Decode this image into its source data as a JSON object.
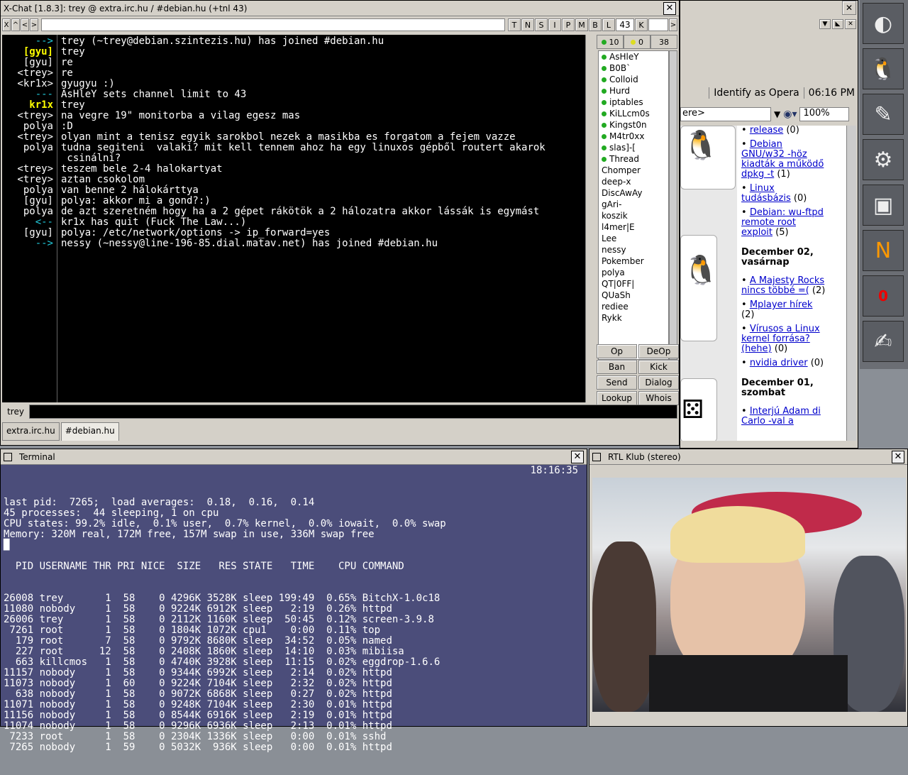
{
  "xchat": {
    "title": "X-Chat [1.8.3]: trey @ extra.irc.hu / #debian.hu (+tnl 43)",
    "toolbar": {
      "btn_x": "X",
      "btn_up": "^",
      "btn_left": "<",
      "btn_right": ">",
      "modes": [
        "T",
        "N",
        "S",
        "I",
        "P",
        "M",
        "B",
        "L"
      ],
      "limit": "43",
      "btn_k": "K",
      "btn_end": ">"
    },
    "lines": [
      {
        "nick": "-->",
        "text": "trey (~trey@debian.szintezis.hu) has joined #debian.hu",
        "type": "join"
      },
      {
        "nick": "[gyu]",
        "text": "trey",
        "type": "hl"
      },
      {
        "nick": "[gyu]",
        "text": "re",
        "type": "n"
      },
      {
        "nick": "<trey>",
        "text": "re",
        "type": "n"
      },
      {
        "nick": "<kr1x>",
        "text": "gyugyu :)",
        "type": "n"
      },
      {
        "nick": "---",
        "text": "AsHleY sets channel limit to 43",
        "type": "sys"
      },
      {
        "nick": "kr1x",
        "text": "trey",
        "type": "hl"
      },
      {
        "nick": "<trey>",
        "text": "na vegre 19\" monitorba a vilag egesz mas",
        "type": "n"
      },
      {
        "nick": "polya",
        "text": ":D",
        "type": "n"
      },
      {
        "nick": "<trey>",
        "text": "olyan mint a tenisz egyik sarokbol nezek a masikba es forgatom a fejem vazze",
        "type": "n"
      },
      {
        "nick": "polya",
        "text": "tudna segiteni  valaki? mit kell tennem ahoz ha egy linuxos gépből routert akarok",
        "type": "n"
      },
      {
        "nick": "",
        "text": " csinálni?",
        "type": "n"
      },
      {
        "nick": "<trey>",
        "text": "teszem bele 2-4 halokartyat",
        "type": "n"
      },
      {
        "nick": "<trey>",
        "text": "aztan csokolom",
        "type": "n"
      },
      {
        "nick": "polya",
        "text": "van benne 2 hálokárttya",
        "type": "n"
      },
      {
        "nick": "[gyu]",
        "text": "polya: akkor mi a gond?:)",
        "type": "n"
      },
      {
        "nick": "polya",
        "text": "de azt szeretném hogy ha a 2 gépet rákötök a 2 hálozatra akkor lássák is egymást",
        "type": "n"
      },
      {
        "nick": "<--",
        "text": "kr1x has quit (Fuck The Law...)",
        "type": "quit"
      },
      {
        "nick": "[gyu]",
        "text": "polya: /etc/network/options -> ip_forward=yes",
        "type": "n"
      },
      {
        "nick": "-->",
        "text": "nessy (~nessy@line-196-85.dial.matav.net) has joined #debian.hu",
        "type": "join2"
      }
    ],
    "counts": {
      "ops": "10",
      "voice": "0",
      "total": "38"
    },
    "users": [
      {
        "name": "AsHleY",
        "op": true
      },
      {
        "name": "B0B`",
        "op": true
      },
      {
        "name": "Colloid",
        "op": true
      },
      {
        "name": "Hurd",
        "op": true
      },
      {
        "name": "iptables",
        "op": true
      },
      {
        "name": "KiLLcm0s",
        "op": true
      },
      {
        "name": "Kingst0n",
        "op": true
      },
      {
        "name": "M4tr0xx",
        "op": true
      },
      {
        "name": "slas]-[",
        "op": true
      },
      {
        "name": "Thread",
        "op": true
      },
      {
        "name": "Chomper",
        "op": false
      },
      {
        "name": "deep-x",
        "op": false
      },
      {
        "name": "DiscAwAy",
        "op": false
      },
      {
        "name": "gAri-",
        "op": false
      },
      {
        "name": "koszik",
        "op": false
      },
      {
        "name": "l4mer|E",
        "op": false
      },
      {
        "name": "Lee",
        "op": false
      },
      {
        "name": "nessy",
        "op": false
      },
      {
        "name": "Pokember",
        "op": false
      },
      {
        "name": "polya",
        "op": false
      },
      {
        "name": "QT|0FF|",
        "op": false
      },
      {
        "name": "QUaSh",
        "op": false
      },
      {
        "name": "rediee",
        "op": false
      },
      {
        "name": "Rykk",
        "op": false
      }
    ],
    "buttons": [
      "Op",
      "DeOp",
      "Ban",
      "Kick",
      "Send",
      "Dialog",
      "Lookup",
      "Whois"
    ],
    "input_nick": "trey",
    "tabs": [
      "extra.irc.hu",
      "#debian.hu"
    ]
  },
  "opera": {
    "identify": "Identify as Opera",
    "time": "06:16 PM",
    "address": "ere>",
    "zoom": "100%",
    "news": [
      {
        "link": "release",
        "count": " (0)"
      },
      {
        "link": "Debian GNU/w32 -höz kiadták a működő dpkg -t",
        "count": " (1)"
      },
      {
        "link": "Linux tudásbázis",
        "count": " (0)"
      },
      {
        "link": "Debian: wu-ftpd remote root exploit",
        "count": " (5)"
      }
    ],
    "day1": "December 02, vasárnap",
    "news2": [
      {
        "link": "A Majesty Rocks nincs többé =(",
        "count": " (2)"
      },
      {
        "link": "Mplayer hírek",
        "count": " (2)"
      },
      {
        "link": "Vírusos a Linux kernel forrása? (hehe)",
        "count": " (0)"
      },
      {
        "link": "nvidia driver",
        "count": " (0)"
      }
    ],
    "day2": "December 01, szombat",
    "news3": [
      {
        "link": "Interjú Adam di Carlo -val a",
        "count": ""
      }
    ]
  },
  "terminal": {
    "title": "Terminal",
    "clock": "18:16:35",
    "header": [
      "last pid:  7265;  load averages:  0.18,  0.16,  0.14",
      "45 processes:  44 sleeping, 1 on cpu",
      "CPU states: 99.2% idle,  0.1% user,  0.7% kernel,  0.0% iowait,  0.0% swap",
      "Memory: 320M real, 172M free, 157M swap in use, 336M swap free",
      "█",
      "",
      "  PID USERNAME THR PRI NICE  SIZE   RES STATE   TIME    CPU COMMAND"
    ],
    "rows": [
      "26008 trey       1  58    0 4296K 3528K sleep 199:49  0.65% BitchX-1.0c18",
      "11080 nobody     1  58    0 9224K 6912K sleep   2:19  0.26% httpd",
      "26006 trey       1  58    0 2112K 1160K sleep  50:45  0.12% screen-3.9.8",
      " 7261 root       1  58    0 1804K 1072K cpu1    0:00  0.11% top",
      "  179 root       7  58    0 9792K 8680K sleep  34:52  0.05% named",
      "  227 root      12  58    0 2408K 1860K sleep  14:10  0.03% mibiisa",
      "  663 killcmos   1  58    0 4740K 3928K sleep  11:15  0.02% eggdrop-1.6.6",
      "11157 nobody     1  58    0 9344K 6992K sleep   2:14  0.02% httpd",
      "11073 nobody     1  60    0 9224K 7104K sleep   2:32  0.02% httpd",
      "  638 nobody     1  58    0 9072K 6868K sleep   0:27  0.02% httpd",
      "11071 nobody     1  58    0 9248K 7104K sleep   2:30  0.01% httpd",
      "11156 nobody     1  58    0 8544K 6916K sleep   2:19  0.01% httpd",
      "11074 nobody     1  58    0 9296K 6936K sleep   2:13  0.01% httpd",
      " 7233 root       1  58    0 2304K 1336K sleep   0:00  0.01% sshd",
      " 7265 nobody     1  59    0 5032K  936K sleep   0:00  0.01% httpd"
    ]
  },
  "tv": {
    "title": "RTL Klub (stereo)"
  },
  "dock": {
    "icons": [
      "gnu-logo-icon",
      "terminal-penguin-icon",
      "graphics-icon",
      "gear-icon",
      "monitor-icon",
      "n-logo-icon",
      "counter-icon",
      "editor-icon"
    ],
    "counter": "0"
  },
  "colors": {
    "xchat_bg": "#000000",
    "highlight": "#ffff00",
    "join": "#22ccdd",
    "term_bg": "#4b4d7a",
    "link": "#0000cc"
  }
}
